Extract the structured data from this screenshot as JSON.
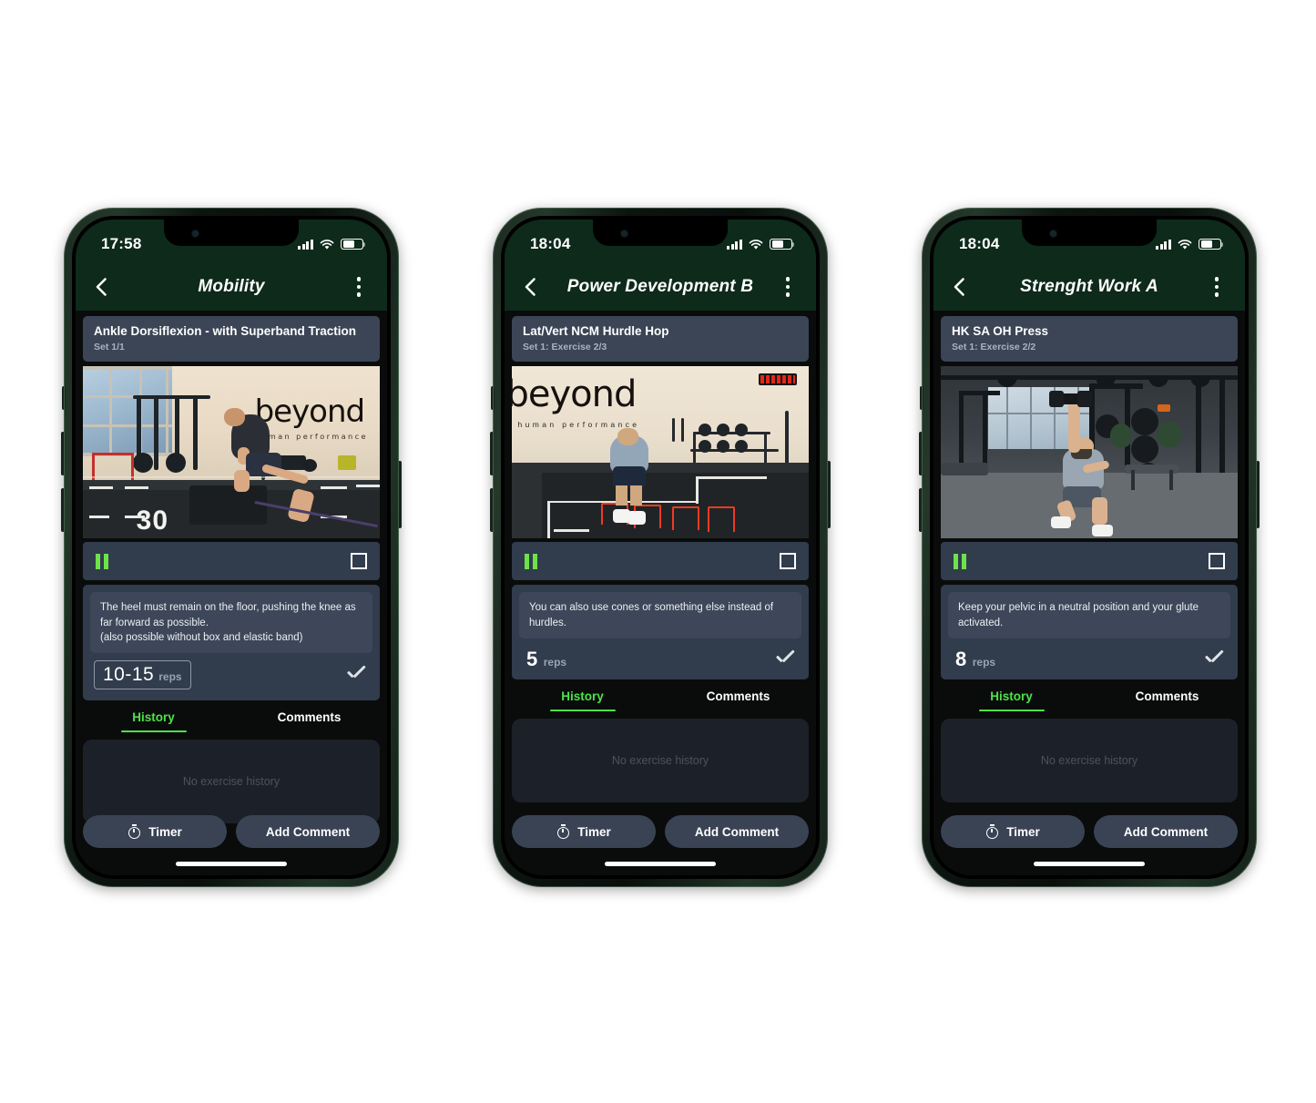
{
  "phones": [
    {
      "id": "phone-1",
      "status": {
        "time": "17:58",
        "signal_icon": "cellular-signal-icon",
        "wifi_icon": "wifi-icon",
        "battery_icon": "battery-icon"
      },
      "nav": {
        "back_icon": "back-chevron-icon",
        "title": "Mobility",
        "menu_icon": "more-vertical-icon"
      },
      "exercise": {
        "name": "Ankle Dorsiflexion - with Superband Traction",
        "subtitle": "Set 1/1"
      },
      "player": {
        "pause_icon": "pause-icon",
        "fullscreen_icon": "fullscreen-icon"
      },
      "note": "The heel must remain on the floor, pushing the knee as far forward as possible.\n(also possible without box and elastic band)",
      "reps": {
        "value": "10-15",
        "unit": "reps",
        "boxed": true,
        "check_icon": "checkmark-icon"
      },
      "tabs": [
        {
          "label": "History",
          "active": true
        },
        {
          "label": "Comments",
          "active": false
        }
      ],
      "history_empty": "No exercise history",
      "actions": {
        "timer_icon": "stopwatch-icon",
        "timer_label": "Timer",
        "comment_label": "Add Comment"
      },
      "video": {
        "scene": "gym-studio-ankle-stretch",
        "brand_text": "beyond",
        "brand_sub": "human performance",
        "floor_number": "30"
      }
    },
    {
      "id": "phone-2",
      "status": {
        "time": "18:04",
        "signal_icon": "cellular-signal-icon",
        "wifi_icon": "wifi-icon",
        "battery_icon": "battery-icon"
      },
      "nav": {
        "back_icon": "back-chevron-icon",
        "title": "Power Development B",
        "menu_icon": "more-vertical-icon"
      },
      "exercise": {
        "name": "Lat/Vert NCM Hurdle Hop",
        "subtitle": "Set 1: Exercise 2/3"
      },
      "player": {
        "pause_icon": "pause-icon",
        "fullscreen_icon": "fullscreen-icon"
      },
      "note": "You can also use cones or something else instead of hurdles.",
      "reps": {
        "value": "5",
        "unit": "reps",
        "boxed": false,
        "check_icon": "checkmark-icon"
      },
      "tabs": [
        {
          "label": "History",
          "active": true
        },
        {
          "label": "Comments",
          "active": false
        }
      ],
      "history_empty": "No exercise history",
      "actions": {
        "timer_icon": "stopwatch-icon",
        "timer_label": "Timer",
        "comment_label": "Add Comment"
      },
      "video": {
        "scene": "gym-studio-hurdle-hop",
        "brand_text": "beyond",
        "brand_sub": "human performance",
        "floor_number": ""
      }
    },
    {
      "id": "phone-3",
      "status": {
        "time": "18:04",
        "signal_icon": "cellular-signal-icon",
        "wifi_icon": "wifi-icon",
        "battery_icon": "battery-icon"
      },
      "nav": {
        "back_icon": "back-chevron-icon",
        "title": "Strenght Work A",
        "menu_icon": "more-vertical-icon"
      },
      "exercise": {
        "name": "HK SA OH Press",
        "subtitle": "Set 1: Exercise 2/2"
      },
      "player": {
        "pause_icon": "pause-icon",
        "fullscreen_icon": "fullscreen-icon"
      },
      "note": "Keep your pelvic in a neutral position and your glute activated.",
      "reps": {
        "value": "8",
        "unit": "reps",
        "boxed": false,
        "check_icon": "checkmark-icon"
      },
      "tabs": [
        {
          "label": "History",
          "active": true
        },
        {
          "label": "Comments",
          "active": false
        }
      ],
      "history_empty": "No exercise history",
      "actions": {
        "timer_icon": "stopwatch-icon",
        "timer_label": "Timer",
        "comment_label": "Add Comment"
      },
      "video": {
        "scene": "commercial-gym-half-kneel-press",
        "brand_text": "",
        "brand_sub": "",
        "floor_number": ""
      }
    }
  ],
  "colors": {
    "accent_green": "#4ee24a",
    "header_green": "#0d2a1b",
    "card_slate": "#3b4556",
    "panel_slate": "#313c4d",
    "note_slate": "#3d4759",
    "button_slate": "#394354",
    "history_dark": "#1c2129",
    "page_background": "#ffffff",
    "frame_green": "#16241b"
  }
}
